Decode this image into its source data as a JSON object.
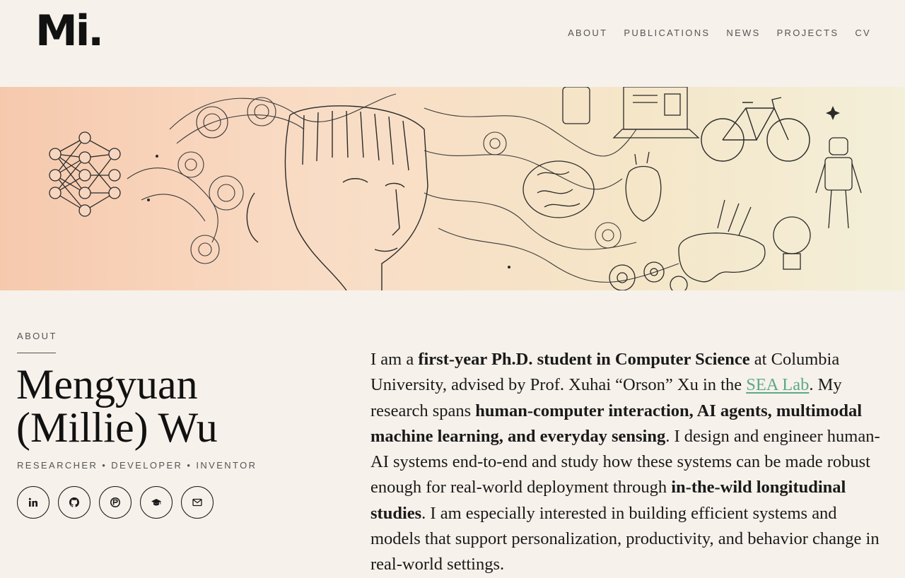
{
  "header": {
    "logo": "Mi.",
    "nav": [
      "ABOUT",
      "PUBLICATIONS",
      "NEWS",
      "PROJECTS",
      "CV"
    ]
  },
  "about": {
    "section_label": "ABOUT",
    "name": "Mengyuan (Millie) Wu",
    "roles": "RESEARCHER • DEVELOPER • INVENTOR",
    "socials": [
      {
        "name": "linkedin",
        "icon": "linkedin-icon"
      },
      {
        "name": "github",
        "icon": "github-icon"
      },
      {
        "name": "website",
        "icon": "globe-icon"
      },
      {
        "name": "google-scholar",
        "icon": "graduation-cap-icon"
      },
      {
        "name": "email",
        "icon": "mail-icon"
      }
    ],
    "bio": {
      "p1": "I am a ",
      "b1": "first-year Ph.D. student in Computer Science",
      "p2": " at Columbia University, advised by Prof. Xuhai “Orson” Xu in the ",
      "link": "SEA Lab",
      "p3": ". My research spans ",
      "b2": "human-computer interaction, AI agents, multimodal machine learning, and everyday sensing",
      "p4": ". I design and engineer human-AI systems end-to-end and study how these systems can be made robust enough for real-world deployment through ",
      "b3": "in-the-wild longitudinal studies",
      "p5": ". I am especially interested in building efficient systems and models that support personalization, productivity, and behavior change in real-world settings."
    }
  },
  "colors": {
    "background": "#f6f1ea",
    "link": "#5da88c",
    "text": "#1a1a1a",
    "muted": "#555555"
  }
}
